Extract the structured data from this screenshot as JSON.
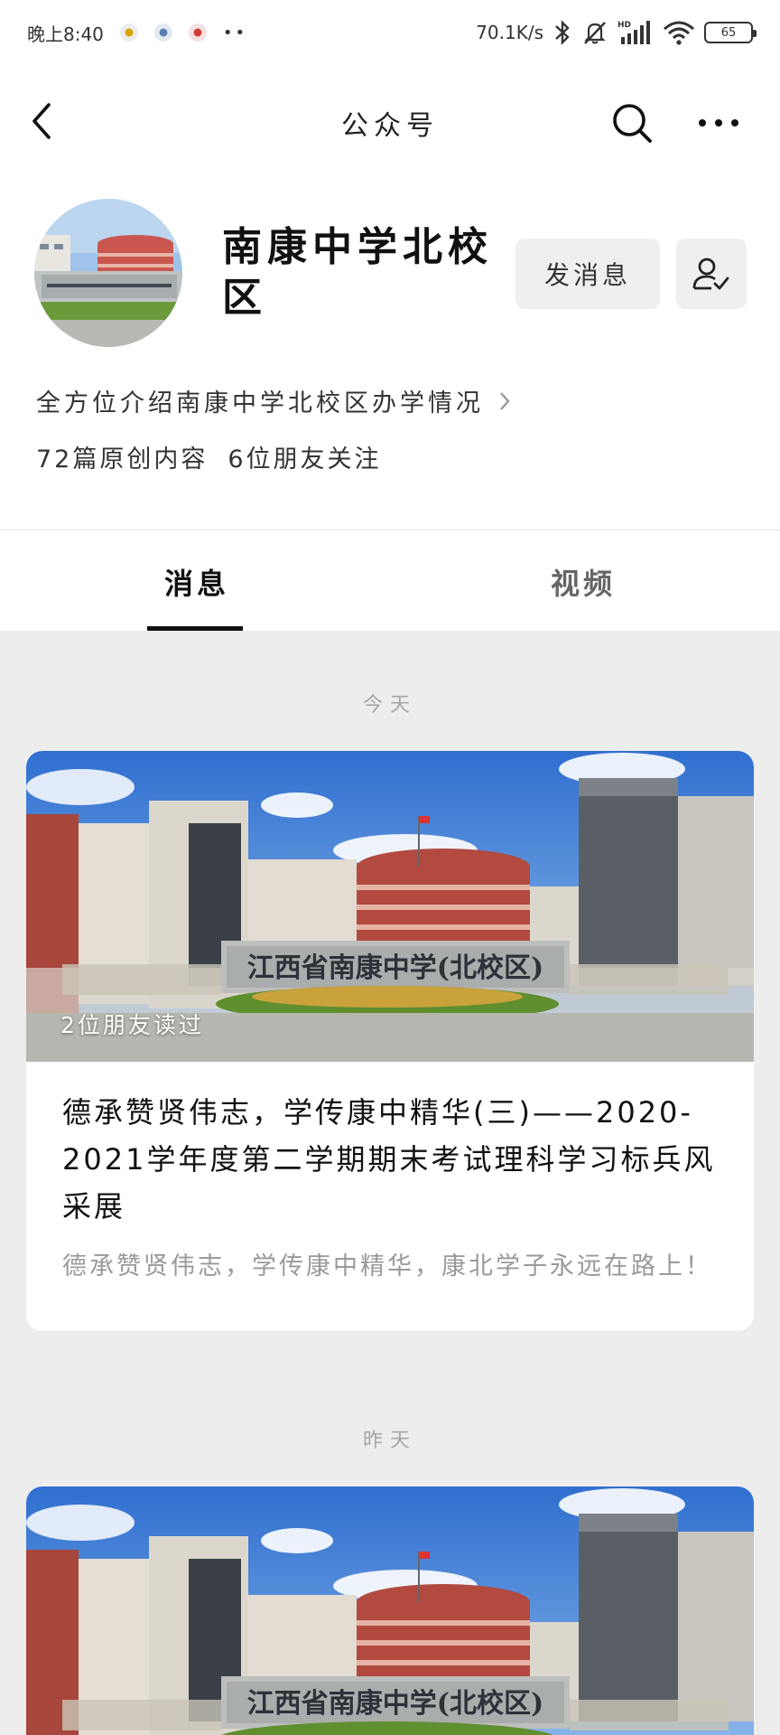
{
  "status_bar": {
    "time": "晚上8:40",
    "notification_icons": [
      "notification-icon-1",
      "notification-icon-2",
      "notification-icon-3"
    ],
    "more_dots": "••",
    "network_speed": "70.1K/s",
    "battery_level": "65"
  },
  "nav": {
    "title": "公众号"
  },
  "account": {
    "name": "南康中学北校区",
    "message_button": "发消息",
    "description": "全方位介绍南康中学北校区办学情况",
    "original_count": "72篇原创内容",
    "friends_following": "6位朋友关注"
  },
  "tabs": [
    {
      "label": "消息",
      "active": true
    },
    {
      "label": "视频",
      "active": false
    }
  ],
  "feed": [
    {
      "date": "今天",
      "read_by": "2位朋友读过",
      "title": "德承赞贤伟志，学传康中精华(三)——2020-2021学年度第二学期期末考试理科学习标兵风采展",
      "digest": "德承赞贤伟志，学传康中精华，康北学子永远在路上！"
    },
    {
      "date": "昨天",
      "read_by": "",
      "title": "",
      "digest": ""
    }
  ],
  "cover_sign_text": "江西省南康中学(北校区)",
  "colors": {
    "accent": "#111111",
    "background": "#ededed",
    "muted_text": "#999999",
    "button_bg": "#efefef"
  }
}
